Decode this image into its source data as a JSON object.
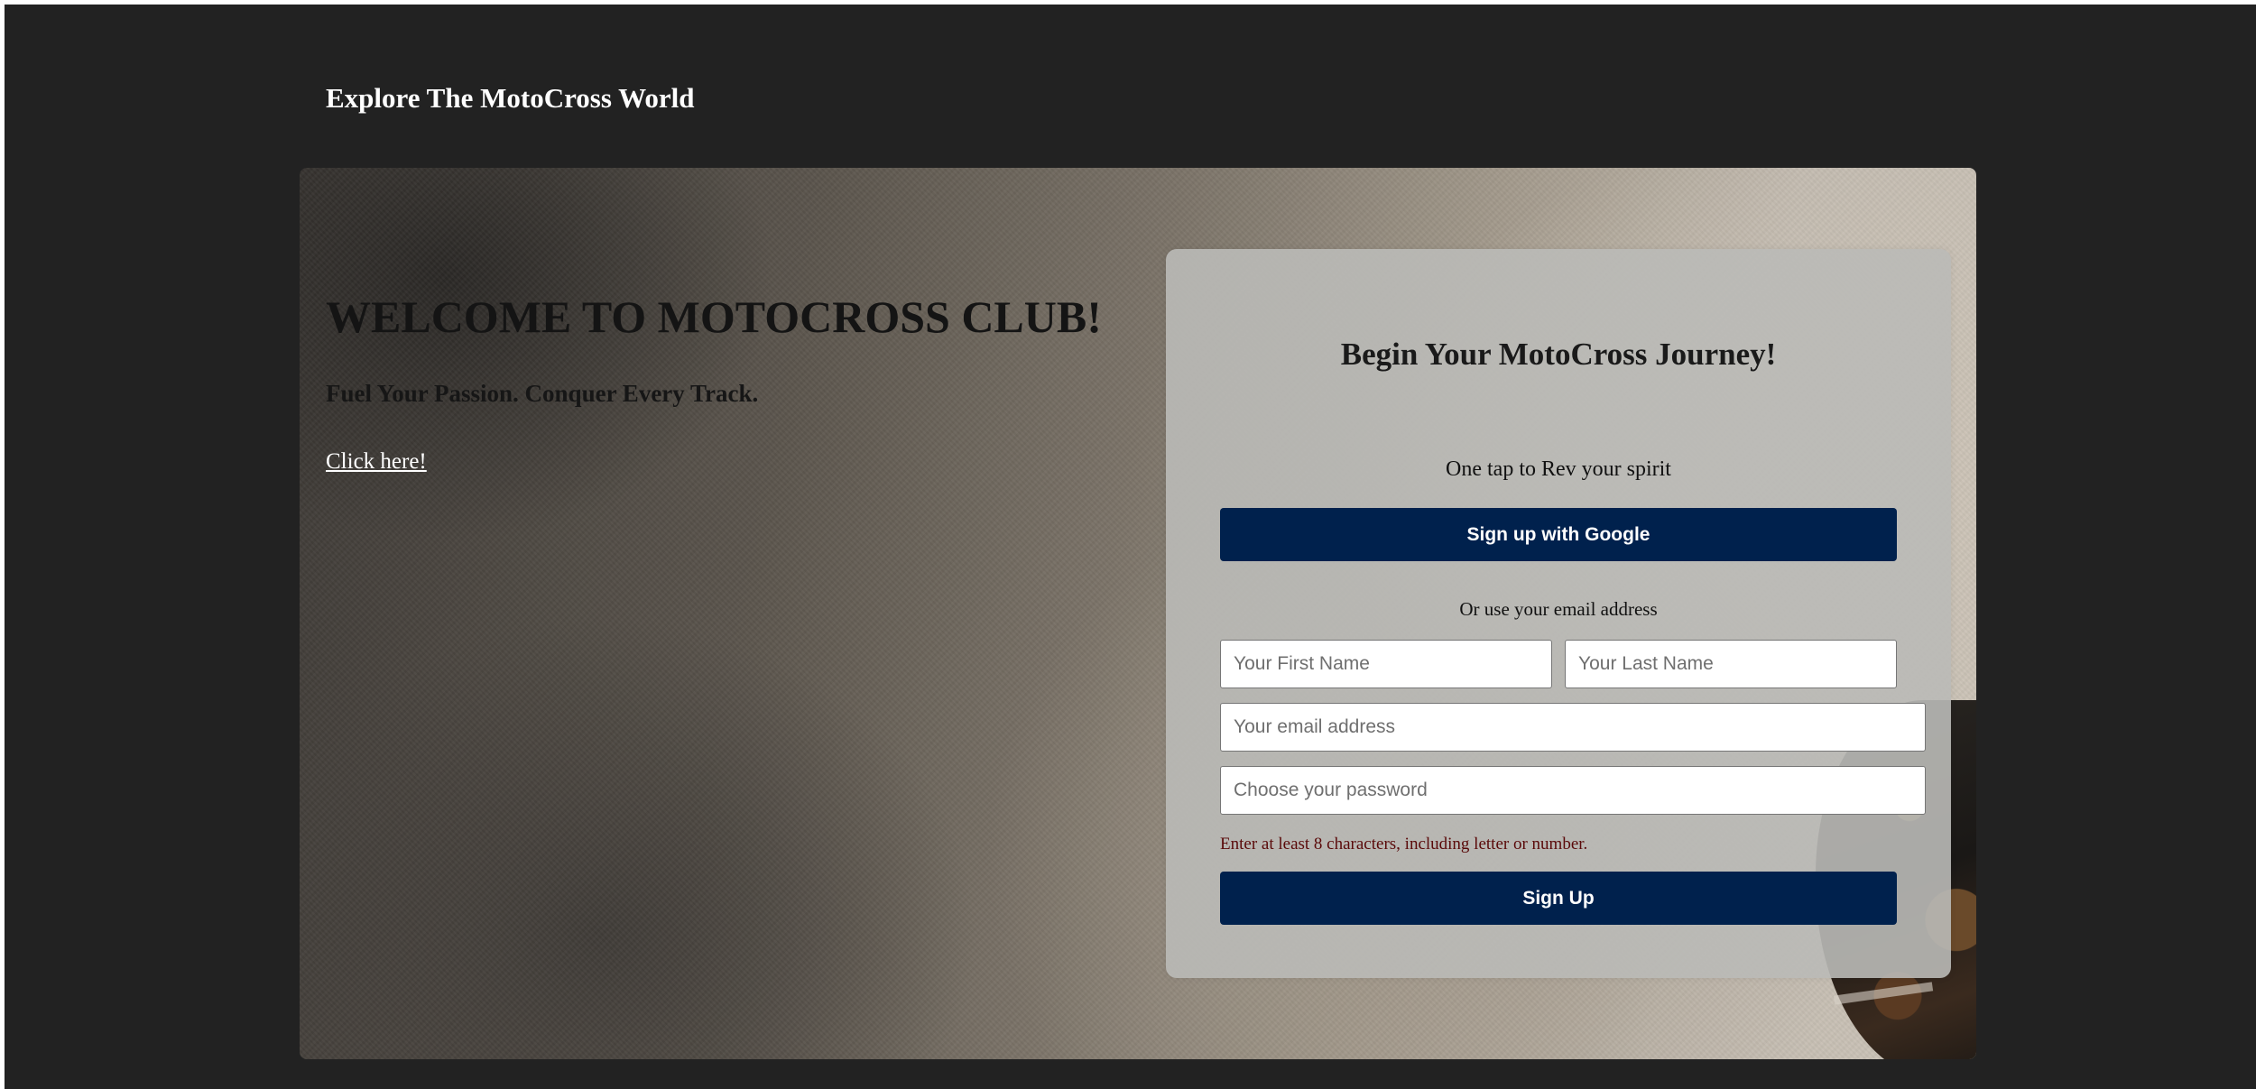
{
  "header": {
    "site_title": "Explore The MotoCross World"
  },
  "hero": {
    "heading": "WELCOME TO MOTOCROSS CLUB!",
    "subheading": "Fuel Your Passion. Conquer Every Track.",
    "cta_link": "Click here!"
  },
  "signup_card": {
    "title": "Begin Your MotoCross Journey!",
    "tagline": "One tap to Rev your spirit",
    "google_button_label": "Sign up with Google",
    "divider_text": "Or use your email address",
    "first_name": {
      "value": "",
      "placeholder": "Your First Name"
    },
    "last_name": {
      "value": "",
      "placeholder": "Your Last Name"
    },
    "email": {
      "value": "",
      "placeholder": "Your email address"
    },
    "password": {
      "value": "",
      "placeholder": "Choose your password"
    },
    "password_hint": "Enter at least 8 characters, including letter or number.",
    "submit_label": "Sign Up"
  },
  "colors": {
    "page_background": "#222222",
    "button_background": "#00214d",
    "button_text": "#ffffff",
    "hint_text": "#5a0a0a"
  }
}
